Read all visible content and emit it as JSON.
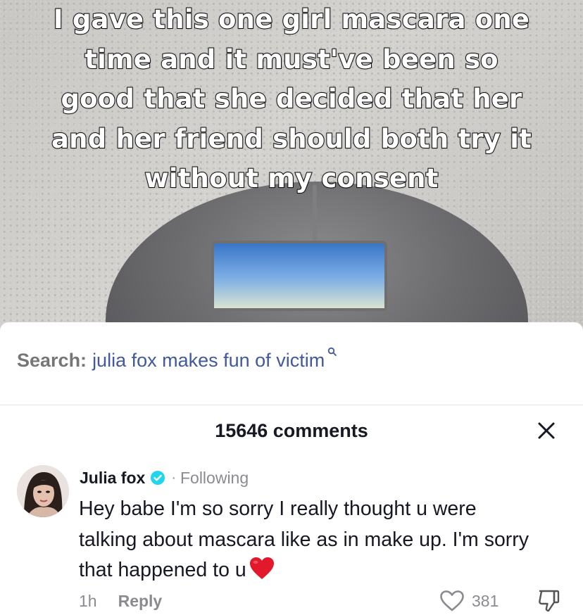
{
  "video": {
    "caption": "I gave this one girl mascara one time and it must've been so good that she decided that her and her friend should both try it without my consent"
  },
  "search": {
    "prefix": "Search:",
    "query": "julia fox makes fun of victim"
  },
  "comments": {
    "count_label": "15646 comments"
  },
  "comment": {
    "author": "Julia fox",
    "separator": "·",
    "follow_status": "Following",
    "text": "Hey babe I'm so sorry I really thought u were talking about mascara like as in make up. I'm sorry that happened to u",
    "time": "1h",
    "reply_label": "Reply",
    "likes": "381"
  },
  "colors": {
    "search_query": "#41599e",
    "verified": "#20d5ec",
    "heart": "#e1192b",
    "muted": "#8a8b91"
  },
  "icons": {
    "search": "search-icon",
    "close": "close-icon",
    "verified": "verified-badge-icon",
    "heart_emoji": "red-heart-emoji-icon",
    "like": "heart-outline-icon",
    "dislike": "thumbs-down-icon"
  }
}
